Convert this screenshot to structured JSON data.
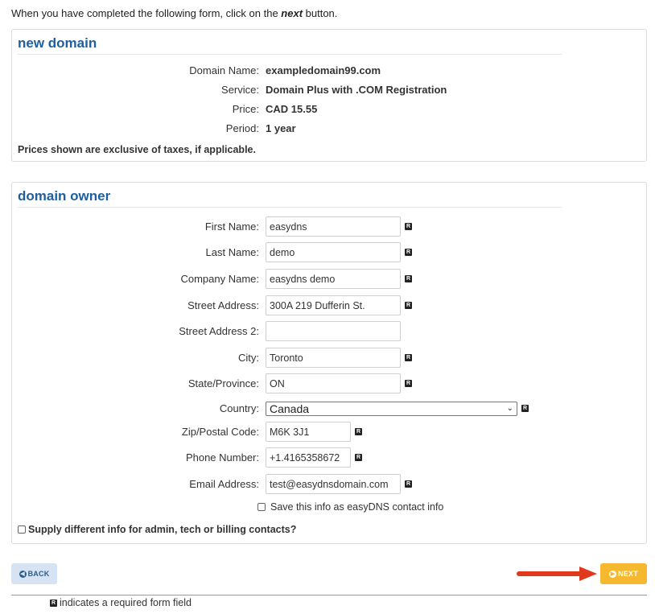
{
  "intro": {
    "before": "When you have completed the following form, click on the ",
    "emphasis": "next",
    "after": " button."
  },
  "new_domain": {
    "title": "new domain",
    "rows": [
      {
        "label": "Domain Name:",
        "value": "exampledomain99.com"
      },
      {
        "label": "Service:",
        "value": "Domain Plus with .COM Registration"
      },
      {
        "label": "Price:",
        "value": "CAD 15.55"
      },
      {
        "label": "Period:",
        "value": "1 year"
      }
    ],
    "note": "Prices shown are exclusive of taxes, if applicable."
  },
  "owner": {
    "title": "domain owner",
    "fields": {
      "first_name": {
        "label": "First Name:",
        "value": "easydns"
      },
      "last_name": {
        "label": "Last Name:",
        "value": "demo"
      },
      "company": {
        "label": "Company Name:",
        "value": "easydns demo"
      },
      "street": {
        "label": "Street Address:",
        "value": "300A 219 Dufferin St."
      },
      "street2": {
        "label": "Street Address 2:",
        "value": ""
      },
      "city": {
        "label": "City:",
        "value": "Toronto"
      },
      "state": {
        "label": "State/Province:",
        "value": "ON"
      },
      "country": {
        "label": "Country:",
        "value": "Canada"
      },
      "zip": {
        "label": "Zip/Postal Code:",
        "value": "M6K 3J1"
      },
      "phone": {
        "label": "Phone Number:",
        "value": "+1.4165358672"
      },
      "email": {
        "label": "Email Address:",
        "value": "test@easydnsdomain.com"
      }
    },
    "save_label": "Save this info as easyDNS contact info",
    "supply_label": "Supply different info for admin, tech or billing contacts?"
  },
  "buttons": {
    "back": "BACK",
    "next": "NEXT"
  },
  "required_glyph": "R",
  "legend": "indicates a required form field",
  "colors": {
    "heading": "#1f5fa0",
    "next_button": "#f5b82e",
    "back_button": "#d5e3f2",
    "arrow": "#e03a1e"
  }
}
